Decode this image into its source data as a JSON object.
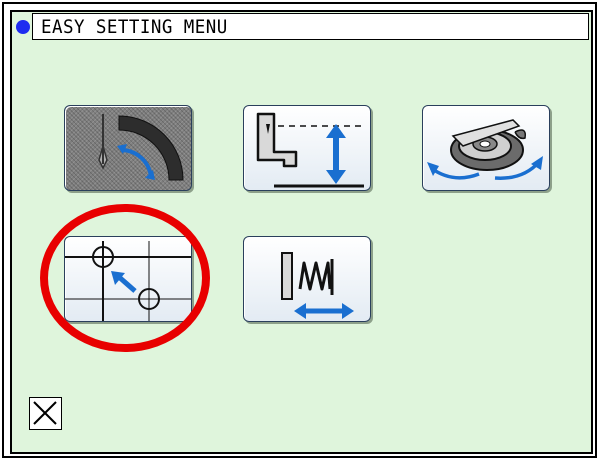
{
  "header": {
    "title": "EASY SETTING MENU",
    "status_dot_color": "#1e2cf0"
  },
  "menu_buttons": [
    {
      "id": "needle-rotation",
      "icon": "needle-rotation-icon",
      "enabled": false
    },
    {
      "id": "presser-foot-height",
      "icon": "presser-foot-height-icon",
      "enabled": true
    },
    {
      "id": "hook-rotation",
      "icon": "rotary-hook-icon",
      "enabled": true
    },
    {
      "id": "origin-position",
      "icon": "origin-position-icon",
      "enabled": true,
      "highlighted": true
    },
    {
      "id": "spring-tension",
      "icon": "spring-tension-icon",
      "enabled": true
    }
  ],
  "footer": {
    "close_icon": "close-icon"
  },
  "colors": {
    "panel_background": "#dff5dc",
    "accent_blue": "#1a6fd0",
    "highlight_ring": "#e80000"
  }
}
